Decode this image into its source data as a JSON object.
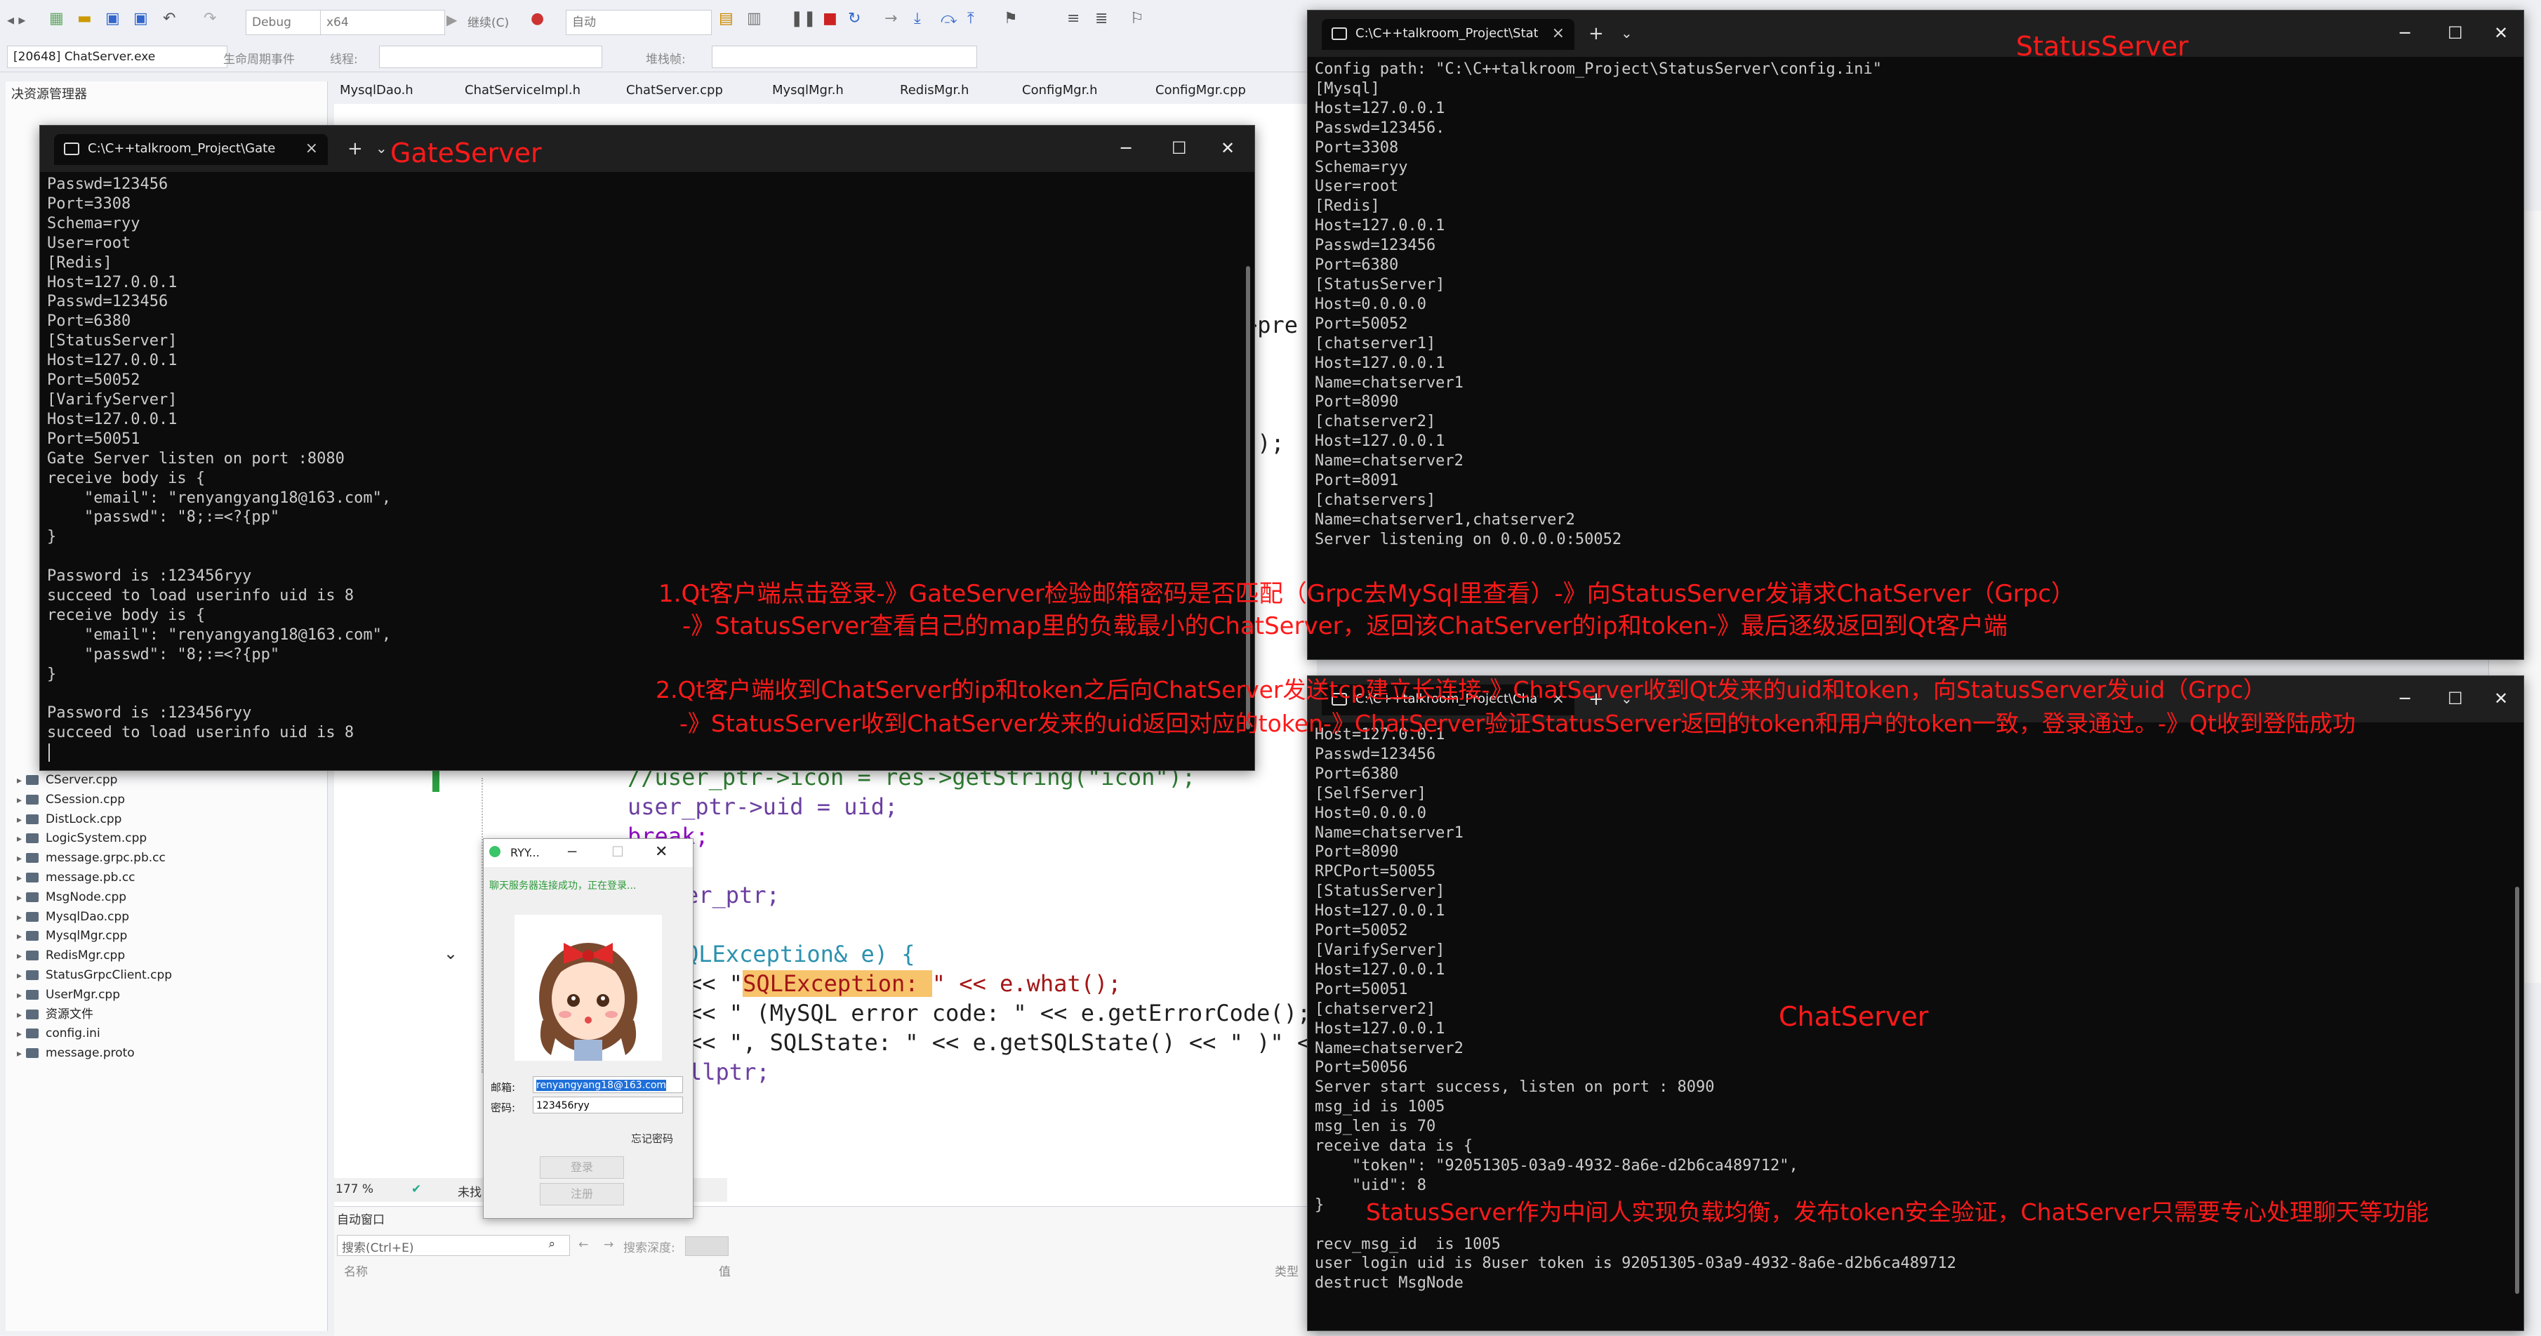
{
  "vs": {
    "process": "[20648] ChatServer.exe",
    "config": "Debug",
    "platform": "x64",
    "continue_label": "继续(C)",
    "auto_label": "自动",
    "lifecycle_label": "生命周期事件",
    "thread_label": "线程:",
    "stack_label": "堆栈帧:",
    "solution_title": "决资源管理器",
    "editor_tabs": [
      "MysqlDao.h",
      "ChatServiceImpl.h",
      "ChatServer.cpp",
      "MysqlMgr.h",
      "RedisMgr.h",
      "ConfigMgr.h",
      "ConfigMgr.cpp"
    ],
    "file_list": [
      {
        "name": "CServer.cpp"
      },
      {
        "name": "CSession.cpp"
      },
      {
        "name": "DistLock.cpp"
      },
      {
        "name": "LogicSystem.cpp"
      },
      {
        "name": "message.grpc.pb.cc"
      },
      {
        "name": "message.pb.cc"
      },
      {
        "name": "MsgNode.cpp"
      },
      {
        "name": "MysqlDao.cpp"
      },
      {
        "name": "MysqlMgr.cpp"
      },
      {
        "name": "RedisMgr.cpp"
      },
      {
        "name": "StatusGrpcClient.cpp"
      },
      {
        "name": "UserMgr.cpp"
      },
      {
        "name": "资源文件"
      },
      {
        "name": "config.ini"
      },
      {
        "name": "message.proto"
      }
    ],
    "code": {
      "line1": "//user_ptr->icon = res->getString(\"icon\");",
      "line2": "user_ptr->uid = uid;",
      "line3": "break;",
      "line4": "er_ptr;",
      "line5": "QLException& e) {",
      "line6a": "<< \"",
      "line6b": "SQLException: ",
      "line6c": "\" << e.what();",
      "line7": "<< \" (MySQL error code: \" << e.getErrorCode();",
      "line8": "<< \", SQLState: \" << e.getSQLState() << \" )\" << st",
      "line9": "llptr;",
      "pre": ">pre",
      "paren": "));"
    },
    "zoom": "177 %",
    "zoom_status": "未找",
    "auto_window_title": "自动窗口",
    "search_placeholder": "搜索(Ctrl+E)",
    "search_depth": "搜索深度:",
    "col_name": "名称",
    "col_value": "值",
    "col_type": "类型"
  },
  "gate": {
    "title": "C:\\C++talkroom_Project\\Gate",
    "label": "GateServer",
    "output": "Passwd=123456\nPort=3308\nSchema=ryy\nUser=root\n[Redis]\nHost=127.0.0.1\nPasswd=123456\nPort=6380\n[StatusServer]\nHost=127.0.0.1\nPort=50052\n[VarifyServer]\nHost=127.0.0.1\nPort=50051\nGate Server listen on port :8080\nreceive body is {\n    \"email\": \"renyangyang18@163.com\",\n    \"passwd\": \"8;:=<?{pp\"\n}\n\nPassword is :123456ryy\nsucceed to load userinfo uid is 8\nreceive body is {\n    \"email\": \"renyangyang18@163.com\",\n    \"passwd\": \"8;:=<?{pp\"\n}\n\nPassword is :123456ryy\nsucceed to load userinfo uid is 8"
  },
  "status": {
    "title": "C:\\C++talkroom_Project\\Statu",
    "label": "StatusServer",
    "output": "Config path: \"C:\\C++talkroom_Project\\StatusServer\\config.ini\"\n[Mysql]\nHost=127.0.0.1\nPasswd=123456.\nPort=3308\nSchema=ryy\nUser=root\n[Redis]\nHost=127.0.0.1\nPasswd=123456\nPort=6380\n[StatusServer]\nHost=0.0.0.0\nPort=50052\n[chatserver1]\nHost=127.0.0.1\nName=chatserver1\nPort=8090\n[chatserver2]\nHost=127.0.0.1\nName=chatserver2\nPort=8091\n[chatservers]\nName=chatserver1,chatserver2\nServer listening on 0.0.0.0:50052"
  },
  "chat": {
    "title": "C:\\C++talkroom_Project\\Chat",
    "label": "ChatServer",
    "output": "Host=127.0.0.1\nPasswd=123456\nPort=6380\n[SelfServer]\nHost=0.0.0.0\nName=chatserver1\nPort=8090\nRPCPort=50055\n[StatusServer]\nHost=127.0.0.1\nPort=50052\n[VarifyServer]\nHost=127.0.0.1\nPort=50051\n[chatserver2]\nHost=127.0.0.1\nName=chatserver2\nPort=50056\nServer start success, listen on port : 8090\nmsg_id is 1005\nmsg_len is 70\nreceive data is {\n    \"token\": \"92051305-03a9-4932-8a6e-d2b6ca489712\",\n    \"uid\": 8\n}\n\nrecv_msg_id  is 1005\nuser login uid is 8user token is 92051305-03a9-4932-8a6e-d2b6ca489712\ndestruct MsgNode"
  },
  "qt": {
    "title": "RYY...",
    "status": "聊天服务器连接成功，正在登录...",
    "email_label": "邮箱:",
    "email_value": "renyangyang18@163.com",
    "password_label": "密码:",
    "password_value": "123456ryy",
    "forgot": "忘记密码",
    "login_btn": "登录",
    "register_btn": "注册"
  },
  "annotations": {
    "a1": "1.Qt客户端点击登录-》GateServer检验邮箱密码是否匹配（Grpc去MySql里查看）-》向StatusServer发请求ChatServer（Grpc）",
    "a2": "-》StatusServer查看自己的map里的负载最小的ChatServer，返回该ChatServer的ip和token-》最后逐级返回到Qt客户端",
    "a3": "2.Qt客户端收到ChatServer的ip和token之后向ChatServer发送tcp建立长连接-》ChatServer收到Qt发来的uid和token，向StatusServer发uid（Grpc）",
    "a4": "-》StatusServer收到ChatServer发来的uid返回对应的token-》ChatServer验证StatusServer返回的token和用户的token一致，登录通过。-》Qt收到登陆成功",
    "a5": "StatusServer作为中间人实现负载均衡，发布token安全验证，ChatServer只需要专心处理聊天等功能"
  },
  "colors": {
    "annotation": "#ff1a1a",
    "console_bg": "#0c0c0c",
    "console_text": "#cccccc",
    "highlight": "#f7c36b"
  }
}
